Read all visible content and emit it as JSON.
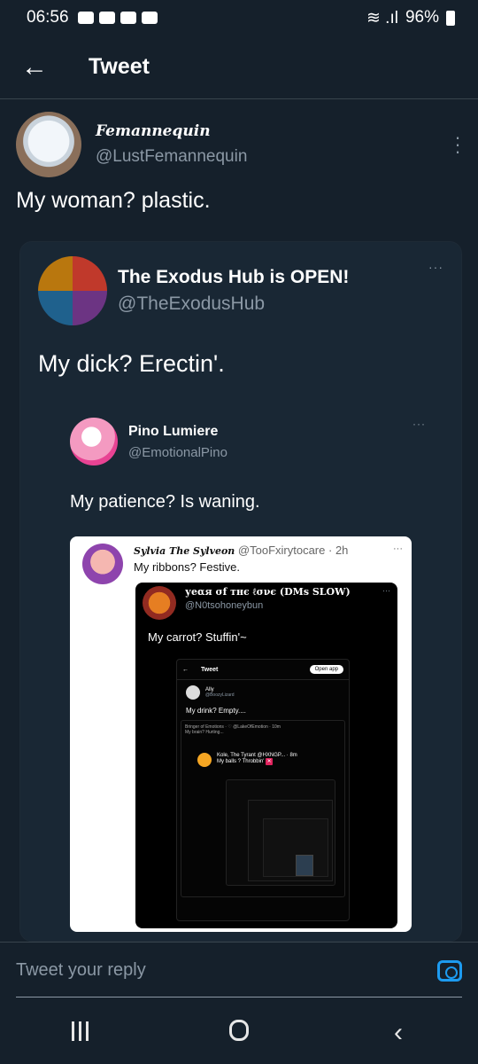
{
  "status": {
    "time": "06:56",
    "battery": "96%"
  },
  "header": {
    "title": "Tweet"
  },
  "tweet": {
    "display_name": "Femannequin",
    "handle": "@LustFemannequin",
    "text": "My woman? plastic."
  },
  "quote": {
    "display_name": "The Exodus Hub is OPEN!",
    "handle": "@TheExodusHub",
    "text": "My dick? Erectin'.",
    "more": "···"
  },
  "nested": {
    "display_name": "Pino Lumiere",
    "handle": "@EmotionalPino",
    "text": "My patience? Is waning.",
    "more": "···"
  },
  "screenshot": {
    "author": "Sylvia The Sylveon",
    "handle": "@TooFxirytocare",
    "time": "· 2h",
    "text": "My ribbons? Festive.",
    "inner_author": "уеαя σf тнє ℓσνє (DMs SLOW)",
    "inner_handle": "@N0tsohoneybun",
    "inner_text": "My carrot? Stuffin'~",
    "deep_header": "Tweet",
    "open_app": "Open app",
    "ally_name": "Ally",
    "ally_handle": "@BoozyLizard",
    "drink_text": "My drink? Empty....",
    "bringer_line": "Bringer of Emotions · ♡ @LakeOfEmotion · 10m",
    "brain_text": "My brain? Hurting...",
    "kole_name": "Kole, The Tyrant @HXNGP... · 8m",
    "kole_text": "My balls ? Throbbin'"
  },
  "reply": {
    "placeholder": "Tweet your reply"
  },
  "icons": {
    "back": "back-arrow-icon",
    "more": "more-vertical-icon",
    "camera": "camera-icon",
    "accent": "#1d9bf0"
  }
}
